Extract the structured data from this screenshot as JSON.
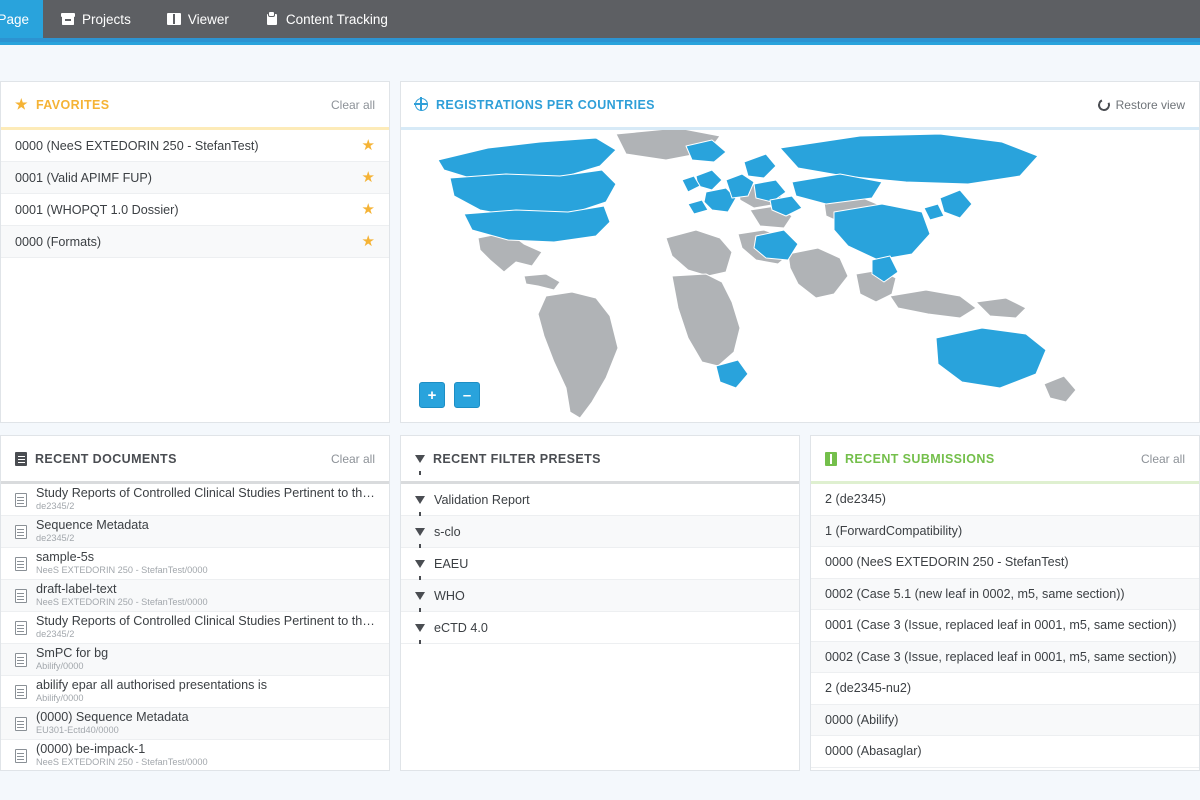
{
  "toolbar": {
    "tabs": [
      {
        "label": "art Page",
        "icon": "none",
        "active": true
      },
      {
        "label": "Projects",
        "icon": "projects-icon",
        "active": false
      },
      {
        "label": "Viewer",
        "icon": "book-icon",
        "active": false
      },
      {
        "label": "Content Tracking",
        "icon": "clipboard-icon",
        "active": false
      }
    ]
  },
  "favorites": {
    "title": "FAVORITES",
    "clear_label": "Clear all",
    "items": [
      {
        "label": "0000 (NeeS EXTEDORIN 250 - StefanTest)"
      },
      {
        "label": "0001 (Valid APIMF FUP)"
      },
      {
        "label": "0001 (WHOPQT 1.0 Dossier)"
      },
      {
        "label": "0000 (Formats)"
      }
    ]
  },
  "map": {
    "title": "REGISTRATIONS PER COUNTRIES",
    "restore_label": "Restore view",
    "zoom_in": "+",
    "zoom_out": "–",
    "colors": {
      "highlight": "#29a3dc",
      "base": "#b0b3b6",
      "border": "#ffffff"
    },
    "highlighted_countries": [
      "United States",
      "Canada",
      "Greenland-partial",
      "United Kingdom",
      "Ireland",
      "France",
      "Germany",
      "Netherlands",
      "Belgium",
      "Denmark",
      "Norway",
      "Sweden",
      "Finland",
      "Poland",
      "Czechia",
      "Austria",
      "Hungary",
      "Romania",
      "Bulgaria",
      "Portugal-partial",
      "Russia",
      "Kazakhstan",
      "China",
      "Japan",
      "South Korea",
      "Vietnam",
      "Saudi Arabia",
      "Australia",
      "South Africa"
    ]
  },
  "recent_documents": {
    "title": "RECENT DOCUMENTS",
    "clear_label": "Clear all",
    "items": [
      {
        "name": "Study Reports of Controlled Clinical Studies Pertinent to the Claimed...",
        "path": "de2345/2"
      },
      {
        "name": "Sequence Metadata",
        "path": "de2345/2"
      },
      {
        "name": "sample-5s",
        "path": "NeeS EXTEDORIN 250 - StefanTest/0000"
      },
      {
        "name": "draft-label-text",
        "path": "NeeS EXTEDORIN 250 - StefanTest/0000"
      },
      {
        "name": "Study Reports of Controlled Clinical Studies Pertinent to the Claimed...",
        "path": "de2345/2"
      },
      {
        "name": "SmPC for bg",
        "path": "Abilify/0000"
      },
      {
        "name": "abilify epar all authorised presentations is",
        "path": "Abilify/0000"
      },
      {
        "name": "(0000) Sequence Metadata",
        "path": "EU301-Ectd40/0000"
      },
      {
        "name": "(0000) be-impack-1",
        "path": "NeeS EXTEDORIN 250 - StefanTest/0000"
      }
    ]
  },
  "recent_filter_presets": {
    "title": "RECENT FILTER PRESETS",
    "items": [
      {
        "label": "Validation Report"
      },
      {
        "label": "s-clo"
      },
      {
        "label": "EAEU"
      },
      {
        "label": "WHO"
      },
      {
        "label": "eCTD 4.0"
      }
    ]
  },
  "recent_submissions": {
    "title": "RECENT SUBMISSIONS",
    "clear_label": "Clear all",
    "items": [
      {
        "label": "2 (de2345)"
      },
      {
        "label": "1 (ForwardCompatibility)"
      },
      {
        "label": "0000 (NeeS EXTEDORIN 250 - StefanTest)"
      },
      {
        "label": "0002 (Case 5.1 (new leaf in 0002, m5, same section))"
      },
      {
        "label": "0001 (Case 3 (Issue, replaced leaf in 0001, m5, same section))"
      },
      {
        "label": "0002 (Case 3 (Issue, replaced leaf in 0001, m5, same section))"
      },
      {
        "label": "2 (de2345-nu2)"
      },
      {
        "label": "0000 (Abilify)"
      },
      {
        "label": "0000 (Abasaglar)"
      }
    ]
  }
}
